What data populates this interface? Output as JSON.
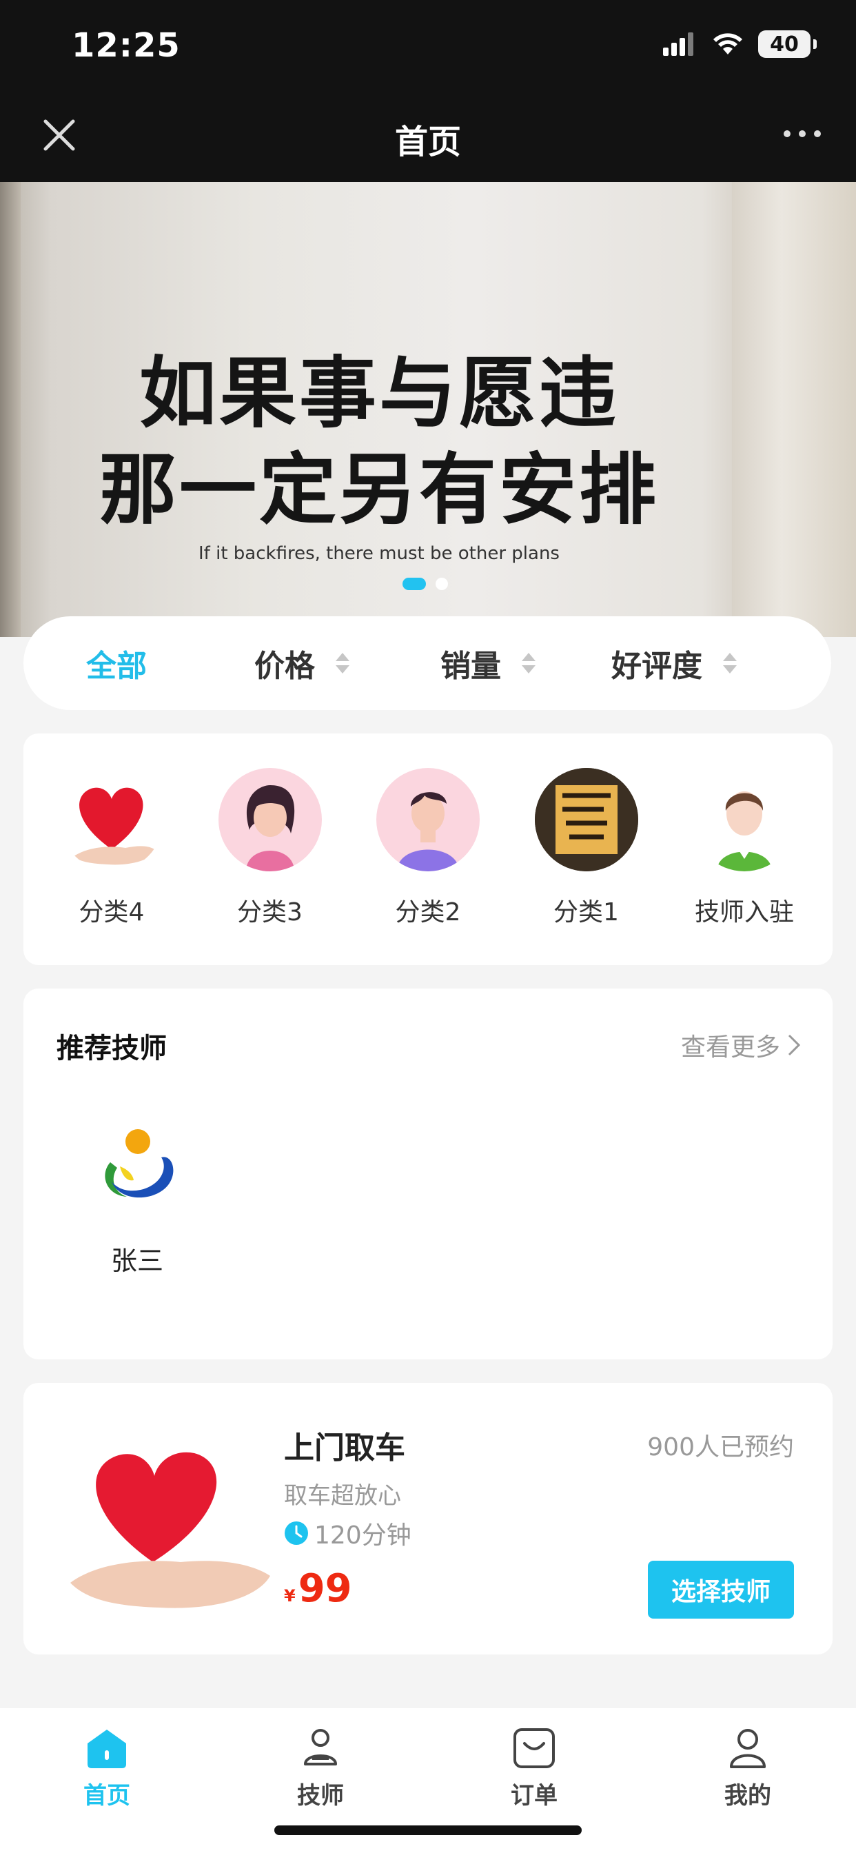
{
  "status": {
    "time": "12:25",
    "battery": "40"
  },
  "nav": {
    "title": "首页"
  },
  "banner": {
    "line1": "如果事与愿违",
    "line2": "那一定另有安排",
    "subtitle": "If it backfires, there must be other plans",
    "slides": 2,
    "active_slide": 1
  },
  "sort": {
    "items": [
      {
        "label": "全部",
        "active": true
      },
      {
        "label": "价格"
      },
      {
        "label": "销量"
      },
      {
        "label": "好评度"
      }
    ]
  },
  "categories": [
    {
      "label": "分类4",
      "icon": "heart-hand-icon"
    },
    {
      "label": "分类3",
      "icon": "woman-avatar-icon"
    },
    {
      "label": "分类2",
      "icon": "man-avatar-icon"
    },
    {
      "label": "分类1",
      "icon": "calligraphy-avatar-icon"
    },
    {
      "label": "技师入驻",
      "icon": "receptionist-avatar-icon"
    }
  ],
  "recommended": {
    "title": "推荐技师",
    "more": "查看更多",
    "technicians": [
      {
        "name": "张三",
        "icon": "technician-logo-icon"
      }
    ]
  },
  "service": {
    "title": "上门取车",
    "booked": "900人已预约",
    "subtitle": "取车超放心",
    "duration": "120分钟",
    "currency": "¥",
    "price": "99",
    "button": "选择技师"
  },
  "tabs": [
    {
      "label": "首页",
      "active": true
    },
    {
      "label": "技师"
    },
    {
      "label": "订单"
    },
    {
      "label": "我的"
    }
  ],
  "colors": {
    "accent": "#1ec3ef",
    "price": "#ee2a12",
    "topbar": "#121212"
  }
}
